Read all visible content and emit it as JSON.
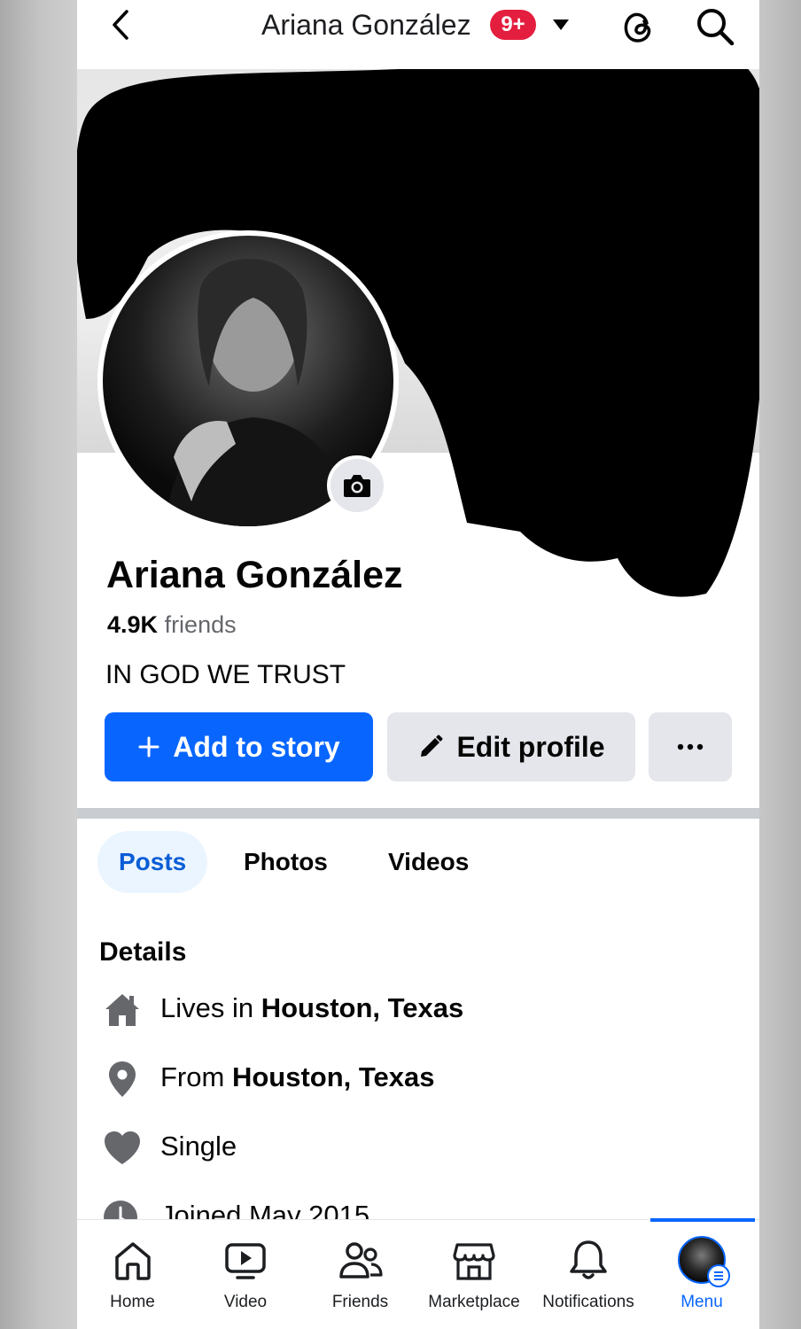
{
  "header": {
    "title": "Ariana González",
    "notification_badge": "9+",
    "icons": [
      "back-chevron-icon",
      "caret-down-icon",
      "threads-icon",
      "search-icon"
    ]
  },
  "profile": {
    "name": "Ariana González",
    "friends_count": "4.9K",
    "friends_label": "friends",
    "bio": "IN GOD WE TRUST"
  },
  "actions": {
    "add_story_label": "Add to story",
    "add_story_icon": "+",
    "edit_profile_label": "Edit profile",
    "more_label": "···"
  },
  "tabs": [
    {
      "label": "Posts",
      "active": true
    },
    {
      "label": "Photos",
      "active": false
    },
    {
      "label": "Videos",
      "active": false
    }
  ],
  "details": {
    "title": "Details",
    "items": [
      {
        "prefix": "Lives in ",
        "bold": "Houston, Texas",
        "icon": "home-icon"
      },
      {
        "prefix": "From ",
        "bold": "Houston, Texas",
        "icon": "location-pin-icon"
      },
      {
        "prefix": "Single",
        "bold": "",
        "icon": "heart-icon"
      },
      {
        "prefix": "Joined May 2015",
        "bold": "",
        "icon": "clock-icon"
      }
    ]
  },
  "bottom_nav": [
    {
      "label": "Home",
      "icon": "home-icon",
      "active": false
    },
    {
      "label": "Video",
      "icon": "video-icon",
      "active": false
    },
    {
      "label": "Friends",
      "icon": "friends-icon",
      "active": false
    },
    {
      "label": "Marketplace",
      "icon": "marketplace-icon",
      "active": false
    },
    {
      "label": "Notifications",
      "icon": "bell-icon",
      "active": false
    },
    {
      "label": "Menu",
      "icon": "profile-avatar-icon",
      "active": true
    }
  ],
  "colors": {
    "accent": "#0866ff",
    "badge": "#e41e3f",
    "button_secondary": "#e4e6eb",
    "tab_active_bg": "#ebf5ff",
    "text_primary": "#050505",
    "text_secondary": "#65676b"
  }
}
